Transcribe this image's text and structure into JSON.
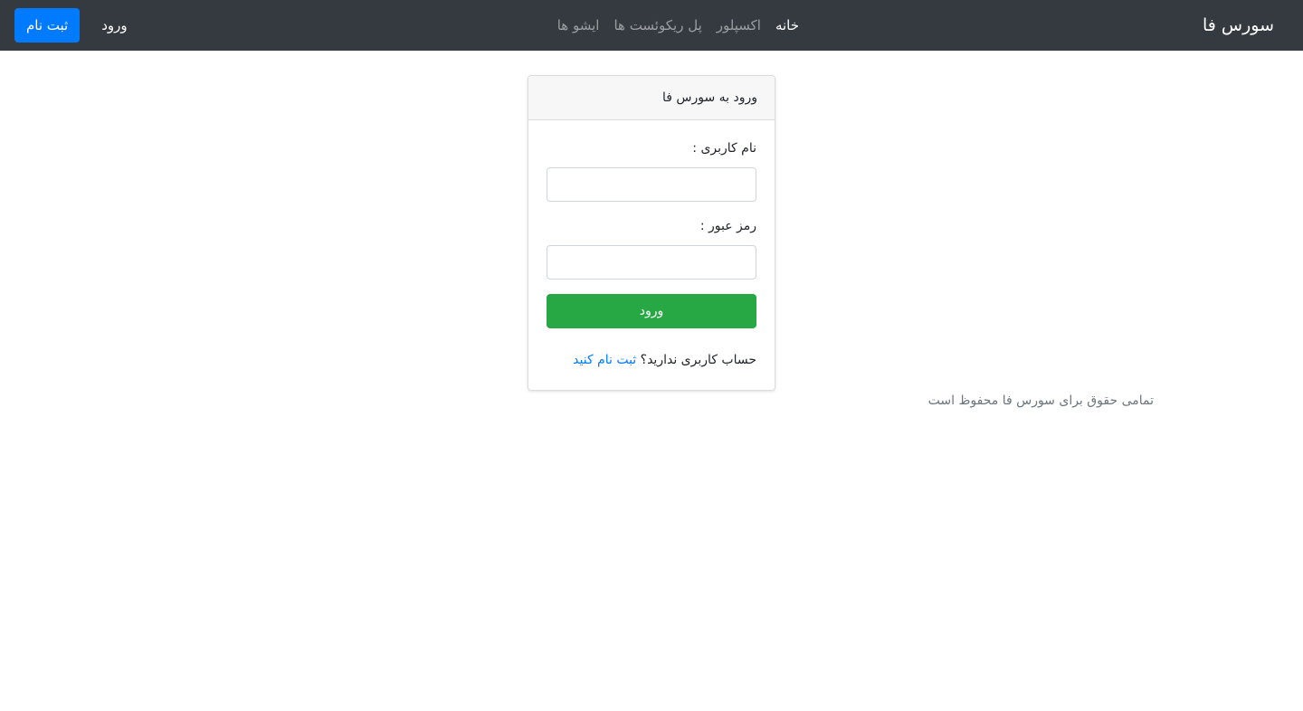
{
  "navbar": {
    "brand": "سورس فا",
    "links": [
      {
        "label": "خانه",
        "active": true
      },
      {
        "label": "اکسپلور",
        "active": false
      },
      {
        "label": "پل ریکوئست ها",
        "active": false
      },
      {
        "label": "ایشو ها",
        "active": false
      }
    ],
    "login_label": "ورود",
    "register_label": "ثبت نام"
  },
  "login_card": {
    "title": "ورود به سورس فا",
    "username_label": "نام کاربری :",
    "username_value": "",
    "password_label": "رمز عبور :",
    "password_value": "",
    "submit_label": "ورود",
    "no_account_text": "حساب کاربری ندارید؟",
    "signup_link": "ثبت نام کنید"
  },
  "footer": {
    "copyright": "تمامی حقوق برای سورس فا محفوظ است"
  },
  "colors": {
    "navbar_bg": "#343a40",
    "primary": "#007bff",
    "success": "#28a745",
    "muted": "#6c757d"
  }
}
